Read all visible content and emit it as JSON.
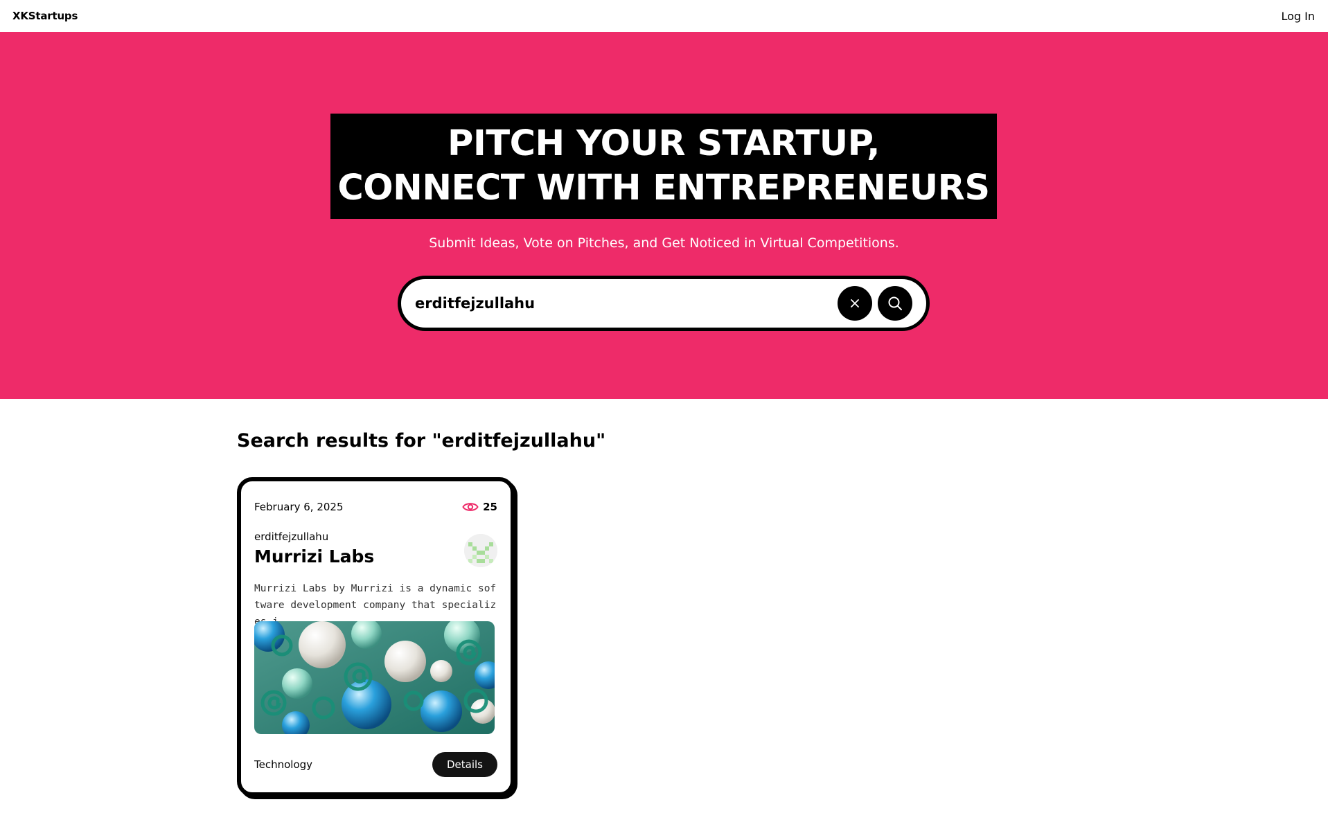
{
  "navbar": {
    "brand": "XKStartups",
    "login_label": "Log In"
  },
  "hero": {
    "headline_line1": "PITCH YOUR STARTUP,",
    "headline_line2": "CONNECT WITH ENTREPRENEURS",
    "subheading": "Submit Ideas, Vote on Pitches, and Get Noticed in Virtual Competitions.",
    "search": {
      "value": "erditfejzullahu",
      "clear_icon": "close-icon",
      "submit_icon": "search-icon"
    }
  },
  "results": {
    "title": "Search results for \"erditfejzullahu\"",
    "cards": [
      {
        "date": "February 6, 2025",
        "views": "25",
        "author": "erditfejzullahu",
        "title": "Murrizi Labs",
        "description": "Murrizi Labs by Murrizi is a dynamic software development company that specializes i...",
        "category": "Technology",
        "details_label": "Details"
      }
    ]
  },
  "colors": {
    "brand_pink": "#EE2B69",
    "dark": "#000000"
  }
}
